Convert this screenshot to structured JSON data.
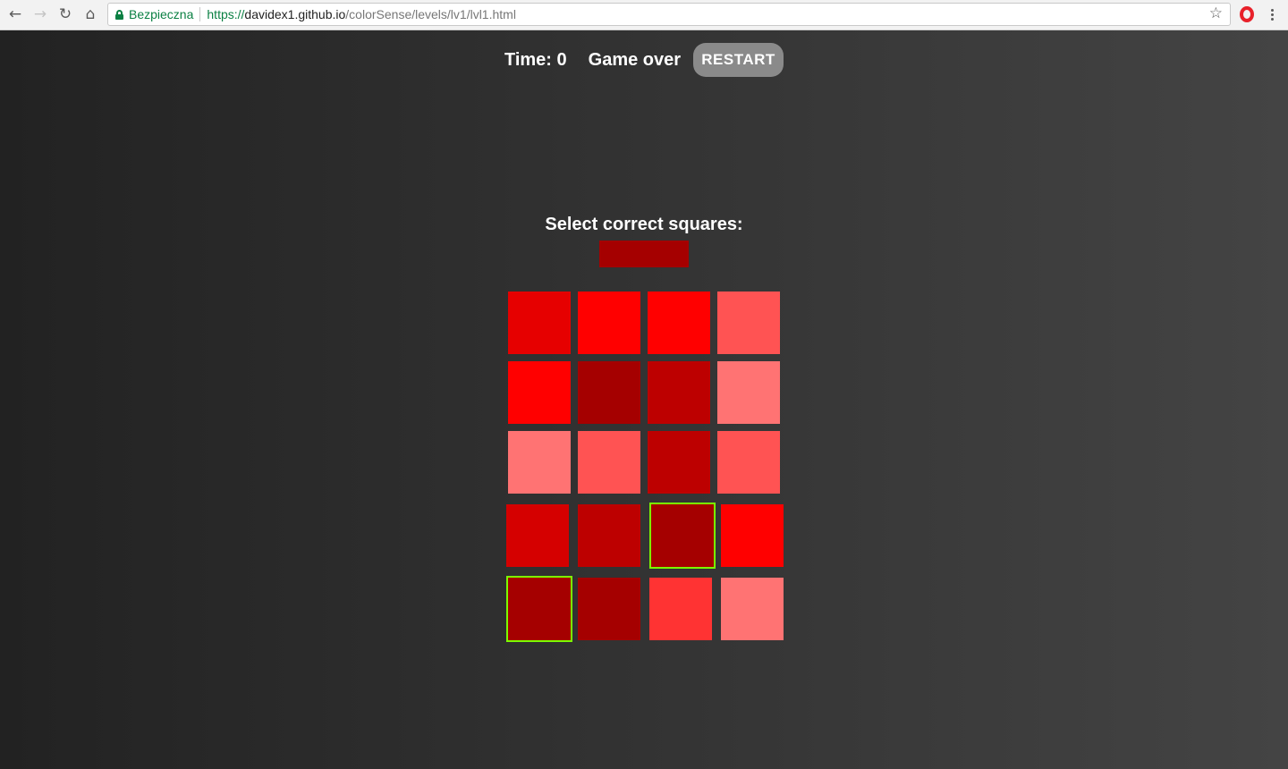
{
  "browser": {
    "secure_label": "Bezpieczna",
    "url_scheme": "https://",
    "url_host": "davidex1.github.io",
    "url_path": "/colorSense/levels/lv1/lvl1.html"
  },
  "game": {
    "time_label": "Time: 0",
    "status_label": "Game over",
    "restart_label": "RESTART",
    "prompt": "Select correct squares:",
    "target_color": "#a50000",
    "grid": [
      [
        {
          "color": "#e60000",
          "selected": false
        },
        {
          "color": "#ff0000",
          "selected": false
        },
        {
          "color": "#ff0000",
          "selected": false
        },
        {
          "color": "#ff5353",
          "selected": false
        }
      ],
      [
        {
          "color": "#ff0000",
          "selected": false
        },
        {
          "color": "#a50000",
          "selected": false
        },
        {
          "color": "#bd0000",
          "selected": false
        },
        {
          "color": "#ff7373",
          "selected": false
        }
      ],
      [
        {
          "color": "#ff7373",
          "selected": false
        },
        {
          "color": "#ff5353",
          "selected": false
        },
        {
          "color": "#bd0000",
          "selected": false
        },
        {
          "color": "#ff5353",
          "selected": false
        }
      ],
      [
        {
          "color": "#d50000",
          "selected": false
        },
        {
          "color": "#bd0000",
          "selected": false
        },
        {
          "color": "#a50000",
          "selected": true
        },
        {
          "color": "#ff0000",
          "selected": false
        }
      ],
      [
        {
          "color": "#a50000",
          "selected": true
        },
        {
          "color": "#a50000",
          "selected": false
        },
        {
          "color": "#ff3333",
          "selected": false
        },
        {
          "color": "#ff7373",
          "selected": false
        }
      ]
    ]
  }
}
